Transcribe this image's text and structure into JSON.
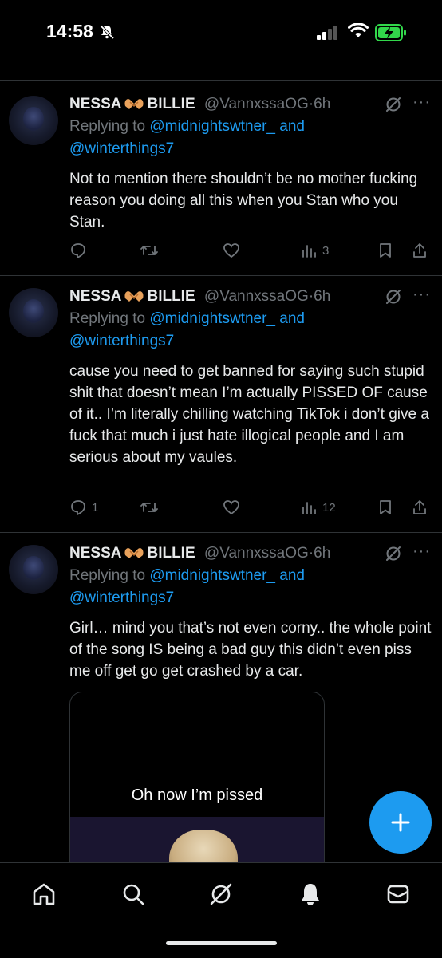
{
  "status_bar": {
    "time": "14:58"
  },
  "tweets": [
    {
      "name_first": "NESSA",
      "name_second": "BILLIE",
      "handle": "@VannxssaOG",
      "separator": "·",
      "time": "6h",
      "replying_prefix": "Replying to",
      "replying_user1": "@midnightswtner_",
      "replying_and": "and",
      "replying_user2": "@winterthings7",
      "text": "Not to mention there shouldn’t be no mother fucking reason you doing all this when you Stan who you Stan.",
      "replies": "",
      "reposts": "",
      "likes": "",
      "views": "3"
    },
    {
      "name_first": "NESSA",
      "name_second": "BILLIE",
      "handle": "@VannxssaOG",
      "separator": "·",
      "time": "6h",
      "replying_prefix": "Replying to",
      "replying_user1": "@midnightswtner_",
      "replying_and": "and",
      "replying_user2": "@winterthings7",
      "text": "cause you need to get banned for saying such stupid shit that doesn’t mean I’m actually PISSED OF cause of it.. I’m literally chilling watching TikTok i don’t give a fuck that much i just hate illogical people and I am serious about my vaules.",
      "replies": "1",
      "reposts": "",
      "likes": "",
      "views": "12"
    },
    {
      "name_first": "NESSA",
      "name_second": "BILLIE",
      "handle": "@VannxssaOG",
      "separator": "·",
      "time": "6h",
      "replying_prefix": "Replying to",
      "replying_user1": "@midnightswtner_",
      "replying_and": "and",
      "replying_user2": "@winterthings7",
      "text": "Girl… mind you that’s not even corny.. the whole point of the song IS being a bad guy this didn’t even piss me off get go get crashed by a car.",
      "media_caption": "Oh now I’m pissed"
    }
  ],
  "colors": {
    "accent": "#1d9bf0",
    "muted": "#71767b",
    "divider": "#2f3336",
    "battery": "#32d74b"
  },
  "nav": [
    "home-icon",
    "search-icon",
    "grok-icon",
    "notifications-icon",
    "messages-icon"
  ]
}
